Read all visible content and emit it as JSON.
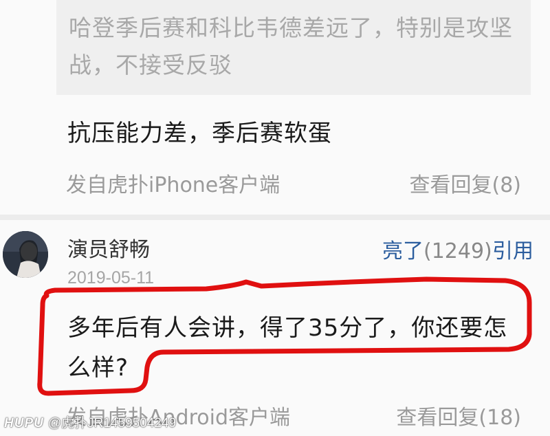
{
  "previous_reply": {
    "quoted_text": "哈登季后赛和科比韦德差远了，特别是攻坚战，不接受反驳",
    "reply_text": "抗压能力差，季后赛软蛋",
    "source": "发自虎扑iPhone客户端",
    "view_replies": "查看回复(8)"
  },
  "comment": {
    "username": "演员舒畅",
    "avatar_icon": "user-avatar-photo",
    "like_label": "亮了",
    "like_count": "(1249)",
    "quote_label": "引用",
    "date": "2019-05-11",
    "text": "多年后有人会讲，得了35分了，你还要怎么样?",
    "source": "发自虎扑Android客户端",
    "view_replies": "查看回复(18)"
  },
  "watermark": {
    "logo": "HUPU",
    "handle": "@虎扑JR1459504249"
  },
  "colors": {
    "link_blue": "#2b5d9e",
    "meta_gray": "#9a9a9a",
    "highlight_red": "#e01010"
  }
}
